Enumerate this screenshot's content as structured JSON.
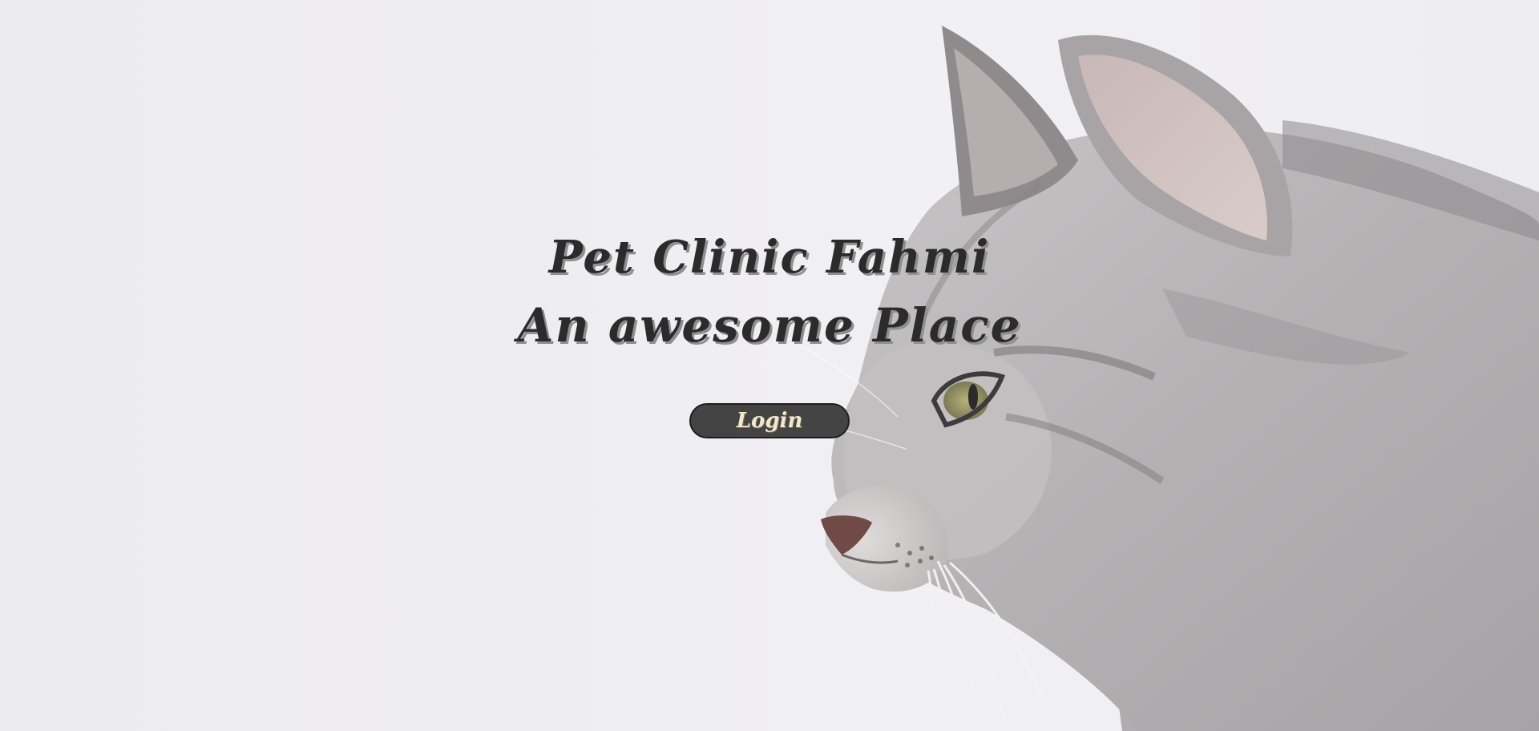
{
  "hero": {
    "title_line1": "Pet Clinic Fahmi",
    "title_line2": "An awesome Place"
  },
  "actions": {
    "login_label": "Login"
  },
  "background": {
    "image": "cat-profile-photo",
    "base_color": "#eeedf1"
  },
  "colors": {
    "title_text": "#2b2b2b",
    "button_bg": "#444444",
    "button_text": "#f3e7cf"
  }
}
